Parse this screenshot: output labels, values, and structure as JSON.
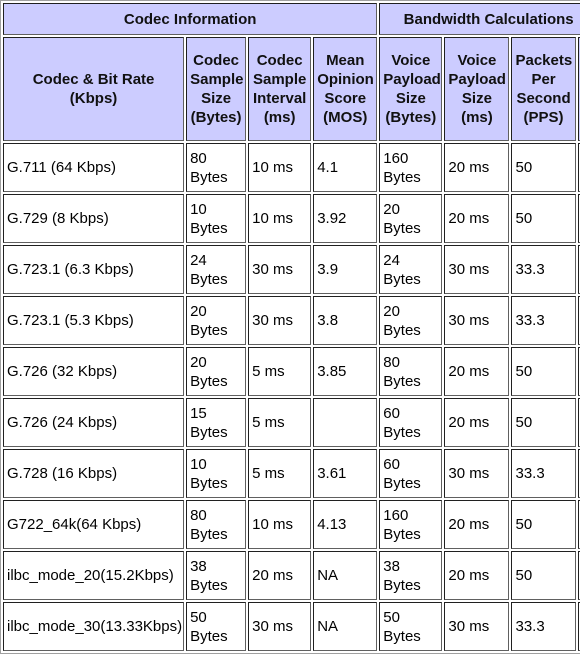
{
  "groups": {
    "codec_info": "Codec Information",
    "bandwidth": "Bandwidth Calculations"
  },
  "columns": [
    "Codec & Bit Rate (Kbps)",
    "Codec Sample Size (Bytes)",
    "Codec Sample Interval (ms)",
    "Mean Opinion Score (MOS)",
    "Voice Payload Size (Bytes)",
    "Voice Payload Size (ms)",
    "Packets Per Second (PPS)"
  ],
  "rows": [
    {
      "codec": "G.711 (64 Kbps)",
      "sample_size": "80 Bytes",
      "sample_interval": "10 ms",
      "mos": "4.1",
      "payload_bytes": "160 Bytes",
      "payload_ms": "20 ms",
      "pps": "50"
    },
    {
      "codec": "G.729 (8 Kbps)",
      "sample_size": "10 Bytes",
      "sample_interval": "10 ms",
      "mos": "3.92",
      "payload_bytes": "20 Bytes",
      "payload_ms": "20 ms",
      "pps": "50"
    },
    {
      "codec": "G.723.1 (6.3 Kbps)",
      "sample_size": "24 Bytes",
      "sample_interval": "30 ms",
      "mos": "3.9",
      "payload_bytes": "24 Bytes",
      "payload_ms": "30 ms",
      "pps": "33.3"
    },
    {
      "codec": "G.723.1 (5.3 Kbps)",
      "sample_size": "20 Bytes",
      "sample_interval": "30 ms",
      "mos": "3.8",
      "payload_bytes": "20 Bytes",
      "payload_ms": "30 ms",
      "pps": "33.3"
    },
    {
      "codec": "G.726 (32 Kbps)",
      "sample_size": "20 Bytes",
      "sample_interval": "5 ms",
      "mos": "3.85",
      "payload_bytes": "80 Bytes",
      "payload_ms": "20 ms",
      "pps": "50"
    },
    {
      "codec": "G.726 (24 Kbps)",
      "sample_size": "15 Bytes",
      "sample_interval": "5 ms",
      "mos": "",
      "payload_bytes": "60 Bytes",
      "payload_ms": "20 ms",
      "pps": "50"
    },
    {
      "codec": "G.728 (16 Kbps)",
      "sample_size": "10 Bytes",
      "sample_interval": "5 ms",
      "mos": "3.61",
      "payload_bytes": "60 Bytes",
      "payload_ms": "30 ms",
      "pps": "33.3"
    },
    {
      "codec": "G722_64k(64 Kbps)",
      "sample_size": "80 Bytes",
      "sample_interval": "10 ms",
      "mos": "4.13",
      "payload_bytes": "160 Bytes",
      "payload_ms": "20 ms",
      "pps": "50"
    },
    {
      "codec": "ilbc_mode_20(15.2Kbps)",
      "sample_size": "38 Bytes",
      "sample_interval": "20 ms",
      "mos": "NA",
      "payload_bytes": "38 Bytes",
      "payload_ms": "20 ms",
      "pps": "50"
    },
    {
      "codec": "ilbc_mode_30(13.33Kbps)",
      "sample_size": "50 Bytes",
      "sample_interval": "30 ms",
      "mos": "NA",
      "payload_bytes": "50 Bytes",
      "payload_ms": "30 ms",
      "pps": "33.3"
    }
  ],
  "colors": {
    "header_bg": "#ccccff",
    "cell_bg": "#ffffff"
  }
}
